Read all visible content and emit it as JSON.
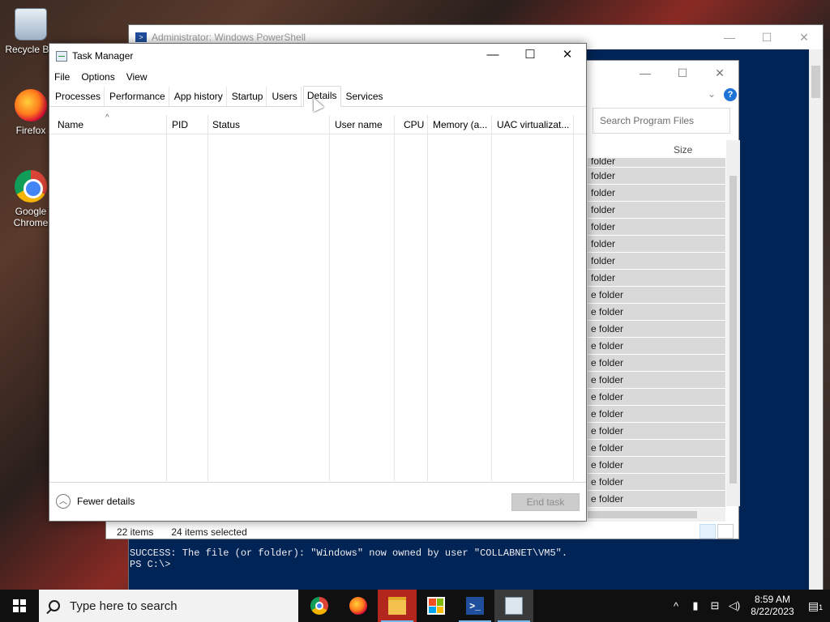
{
  "desktop": {
    "icons": [
      {
        "label": "Recycle Bin"
      },
      {
        "label": "Firefox"
      },
      {
        "label": "Google Chrome"
      }
    ]
  },
  "powershell": {
    "title": "Administrator: Windows PowerShell",
    "output_line1": "SUCCESS: The file (or folder): \"Windows\" now owned by user \"COLLABNET\\VM5\".",
    "output_line2": "PS C:\\>"
  },
  "explorer": {
    "search_placeholder": "Search Program Files",
    "size_column": "Size",
    "row_type": "folder",
    "rows": [
      "folder",
      "folder",
      "folder",
      "folder",
      "folder",
      "folder",
      "folder",
      "folder",
      "e folder",
      "e folder",
      "e folder",
      "e folder",
      "e folder",
      "e folder",
      "e folder",
      "e folder",
      "e folder",
      "e folder",
      "e folder",
      "e folder",
      "e folder"
    ],
    "status_items": "22 items",
    "status_selected": "24 items selected"
  },
  "taskmanager": {
    "title": "Task Manager",
    "menu": [
      "File",
      "Options",
      "View"
    ],
    "tabs": [
      "Processes",
      "Performance",
      "App history",
      "Startup",
      "Users",
      "Details",
      "Services"
    ],
    "active_tab": "Details",
    "columns": [
      "Name",
      "PID",
      "Status",
      "User name",
      "CPU",
      "Memory (a...",
      "UAC virtualizat..."
    ],
    "fewer_details": "Fewer details",
    "end_task": "End task"
  },
  "taskbar": {
    "search_placeholder": "Type here to search",
    "apps": [
      "chrome",
      "firefox",
      "file-explorer",
      "store",
      "powershell",
      "task-manager"
    ],
    "clock_time": "8:59 AM",
    "clock_date": "8/22/2023",
    "notification_count": "1"
  }
}
